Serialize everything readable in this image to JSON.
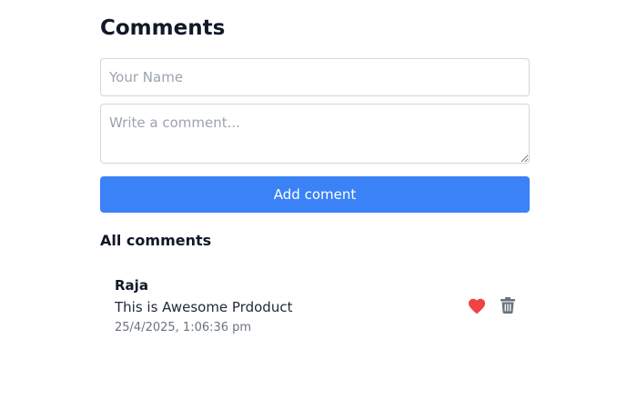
{
  "header": {
    "title": "Comments"
  },
  "form": {
    "name_placeholder": "Your Name",
    "name_value": "",
    "comment_placeholder": "Write a comment...",
    "comment_value": "",
    "submit_label": "Add coment"
  },
  "list": {
    "title": "All comments",
    "comments": [
      {
        "author": "Raja",
        "text": "This is Awesome Prdoduct",
        "timestamp": "25/4/2025, 1:06:36 pm",
        "liked": true,
        "like_icon": "heart-icon",
        "delete_icon": "trash-icon"
      }
    ]
  },
  "colors": {
    "accent": "#3b82f6",
    "heart": "#ef4444",
    "trash": "#6b7280",
    "border": "#d1d5db",
    "muted_text": "#6b7280"
  }
}
